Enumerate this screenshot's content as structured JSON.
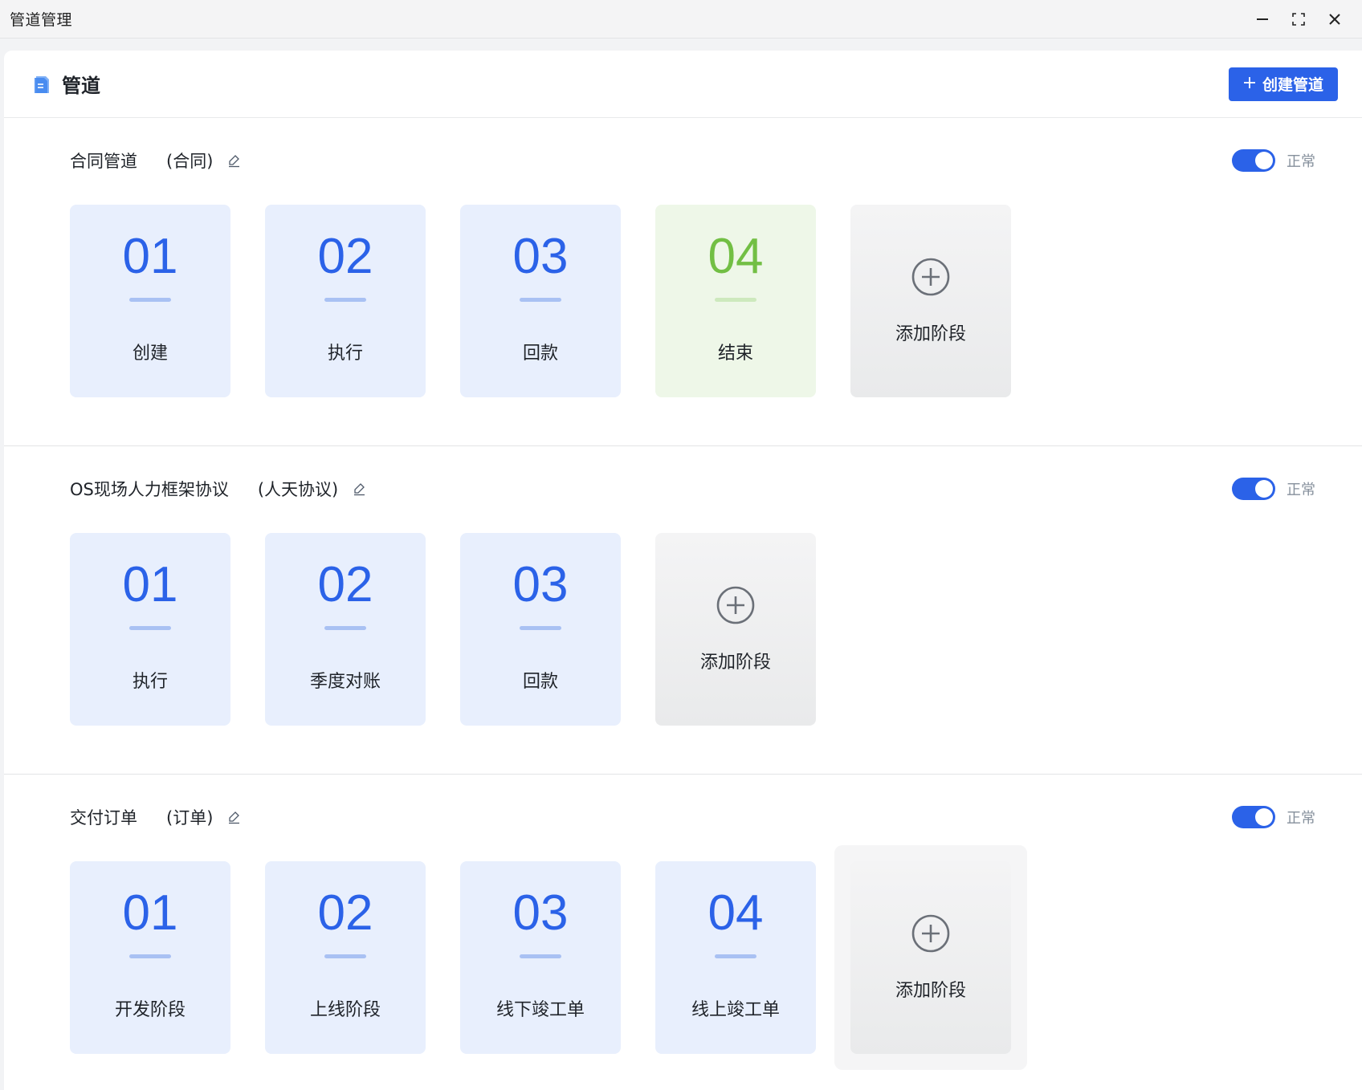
{
  "window": {
    "title": "管道管理"
  },
  "header": {
    "title": "管道",
    "create_button_label": "创建管道"
  },
  "pipelines": [
    {
      "name": "合同管道",
      "type": "(合同)",
      "status": "正常",
      "enabled": true,
      "stages": [
        {
          "num": "01",
          "label": "创建",
          "state": "normal"
        },
        {
          "num": "02",
          "label": "执行",
          "state": "normal"
        },
        {
          "num": "03",
          "label": "回款",
          "state": "normal"
        },
        {
          "num": "04",
          "label": "结束",
          "state": "done"
        }
      ],
      "add_label": "添加阶段"
    },
    {
      "name": "OS现场人力框架协议",
      "type": "(人天协议)",
      "status": "正常",
      "enabled": true,
      "stages": [
        {
          "num": "01",
          "label": "执行",
          "state": "normal"
        },
        {
          "num": "02",
          "label": "季度对账",
          "state": "normal"
        },
        {
          "num": "03",
          "label": "回款",
          "state": "normal"
        }
      ],
      "add_label": "添加阶段"
    },
    {
      "name": "交付订单",
      "type": "(订单)",
      "status": "正常",
      "enabled": true,
      "stages": [
        {
          "num": "01",
          "label": "开发阶段",
          "state": "normal"
        },
        {
          "num": "02",
          "label": "上线阶段",
          "state": "normal"
        },
        {
          "num": "03",
          "label": "线下竣工单",
          "state": "normal"
        },
        {
          "num": "04",
          "label": "线上竣工单",
          "state": "normal"
        }
      ],
      "add_label": "添加阶段"
    }
  ],
  "colors": {
    "accent": "#2b62e8",
    "stage_bg": "#e8effd",
    "done_text": "#72bf44",
    "done_bg": "#eef7e8",
    "status_text": "#86909c"
  }
}
